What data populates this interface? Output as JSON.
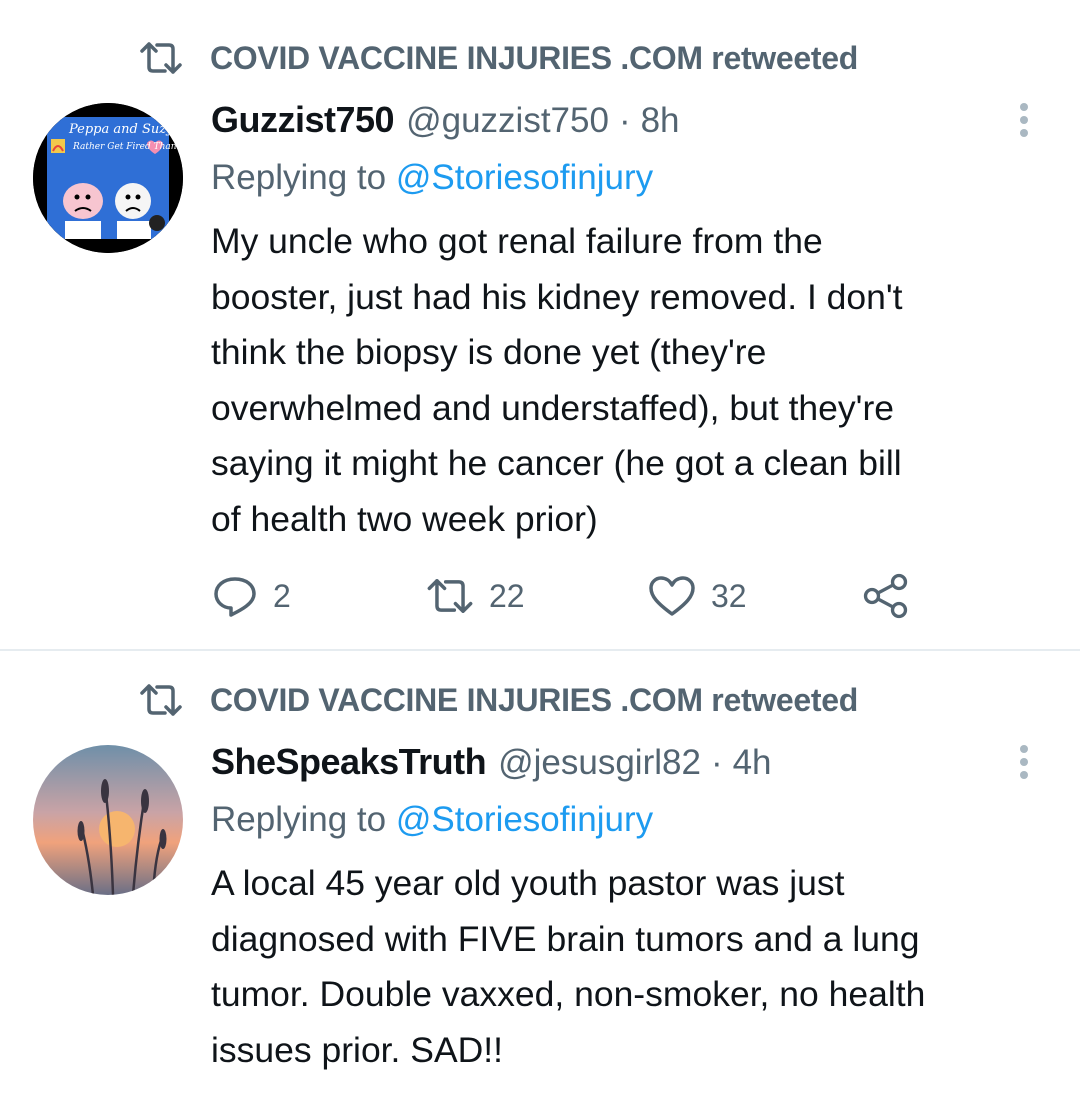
{
  "tweets": [
    {
      "retweeted_by": "COVID VACCINE INJURIES .COM retweeted",
      "avatar": {
        "title": "Peppa and Suzy",
        "caption": "Rather Get Fired Than Get a Vaccine"
      },
      "display_name": "Guzzist750",
      "handle": "@guzzist750",
      "separator": "·",
      "time": "8h",
      "replying_prefix": "Replying to",
      "replying_to": "@Storiesofinjury",
      "body_lines": [
        "My uncle who got renal failure from the",
        "booster, just had his kidney removed. I don't",
        "think the biopsy is done yet (they're",
        "overwhelmed and understaffed), but they're",
        "saying it might he cancer (he got a clean bill",
        "of health two week prior)"
      ],
      "replies": "2",
      "retweets": "22",
      "likes": "32"
    },
    {
      "retweeted_by": "COVID VACCINE INJURIES .COM retweeted",
      "display_name": "SheSpeaksTruth",
      "handle": "@jesusgirl82",
      "separator": "·",
      "time": "4h",
      "replying_prefix": "Replying to",
      "replying_to": "@Storiesofinjury",
      "body_lines": [
        "A local 45 year old youth pastor was just",
        "diagnosed with FIVE brain tumors and a lung",
        "tumor. Double vaxxed, non-smoker, no health",
        "issues prior. SAD!!"
      ]
    }
  ],
  "colors": {
    "text": "#0f1419",
    "secondary": "#536471",
    "link": "#1d9bf0",
    "divider": "#e6ecf0"
  },
  "icons": [
    "retweet-icon",
    "more-icon",
    "reply-icon",
    "like-icon",
    "share-icon"
  ]
}
